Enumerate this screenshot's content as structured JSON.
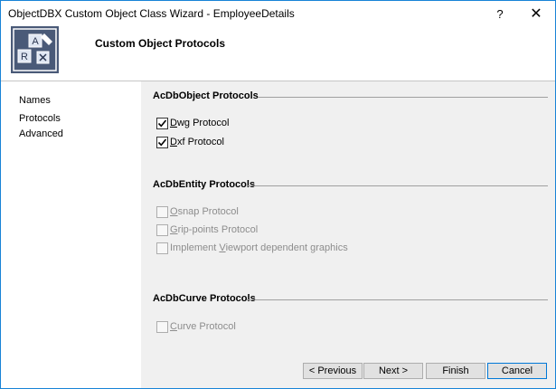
{
  "window": {
    "title": "ObjectDBX Custom Object Class Wizard - EmployeeDetails",
    "help_label": "?",
    "close_label": "✕"
  },
  "header": {
    "title": "Custom Object Protocols",
    "icon": "wizard-blocks-icon",
    "icon_letters": [
      "A",
      "R"
    ]
  },
  "nav": {
    "items": [
      {
        "label": "Names"
      },
      {
        "label": "Protocols",
        "selected": true
      },
      {
        "label": "Advanced"
      }
    ]
  },
  "groups": {
    "dbobject": {
      "title": "AcDbObject Protocols",
      "items": [
        {
          "label_key": "D",
          "label_rest1": "",
          "label_mid": "wg",
          "label_pre": "",
          "checked": true,
          "enabled": true
        },
        {
          "label_key": "D",
          "label_mid": "xf",
          "checked": true,
          "enabled": true
        }
      ],
      "dwg": {
        "underline": "D",
        "rest": "wg Protocol"
      },
      "dxf": {
        "underline": "D",
        "rest": "xf Protocol"
      }
    },
    "entity": {
      "title": "AcDbEntity Protocols",
      "osnap": {
        "underline": "O",
        "rest": "snap Protocol"
      },
      "grip": {
        "underline": "G",
        "rest": "rip-points Protocol"
      },
      "viewport": {
        "pre": "Implement ",
        "underline": "V",
        "rest": "iewport dependent graphics"
      }
    },
    "curve": {
      "title": "AcDbCurve Protocols",
      "curve": {
        "underline": "C",
        "rest": "urve Protocol"
      }
    }
  },
  "buttons": {
    "previous": "< Previous",
    "next": "Next >",
    "finish": "Finish",
    "cancel": "Cancel"
  },
  "colors": {
    "accent_border": "#1883d7",
    "icon_background": "#4a5a78",
    "disabled_text": "#8d8d8d"
  }
}
